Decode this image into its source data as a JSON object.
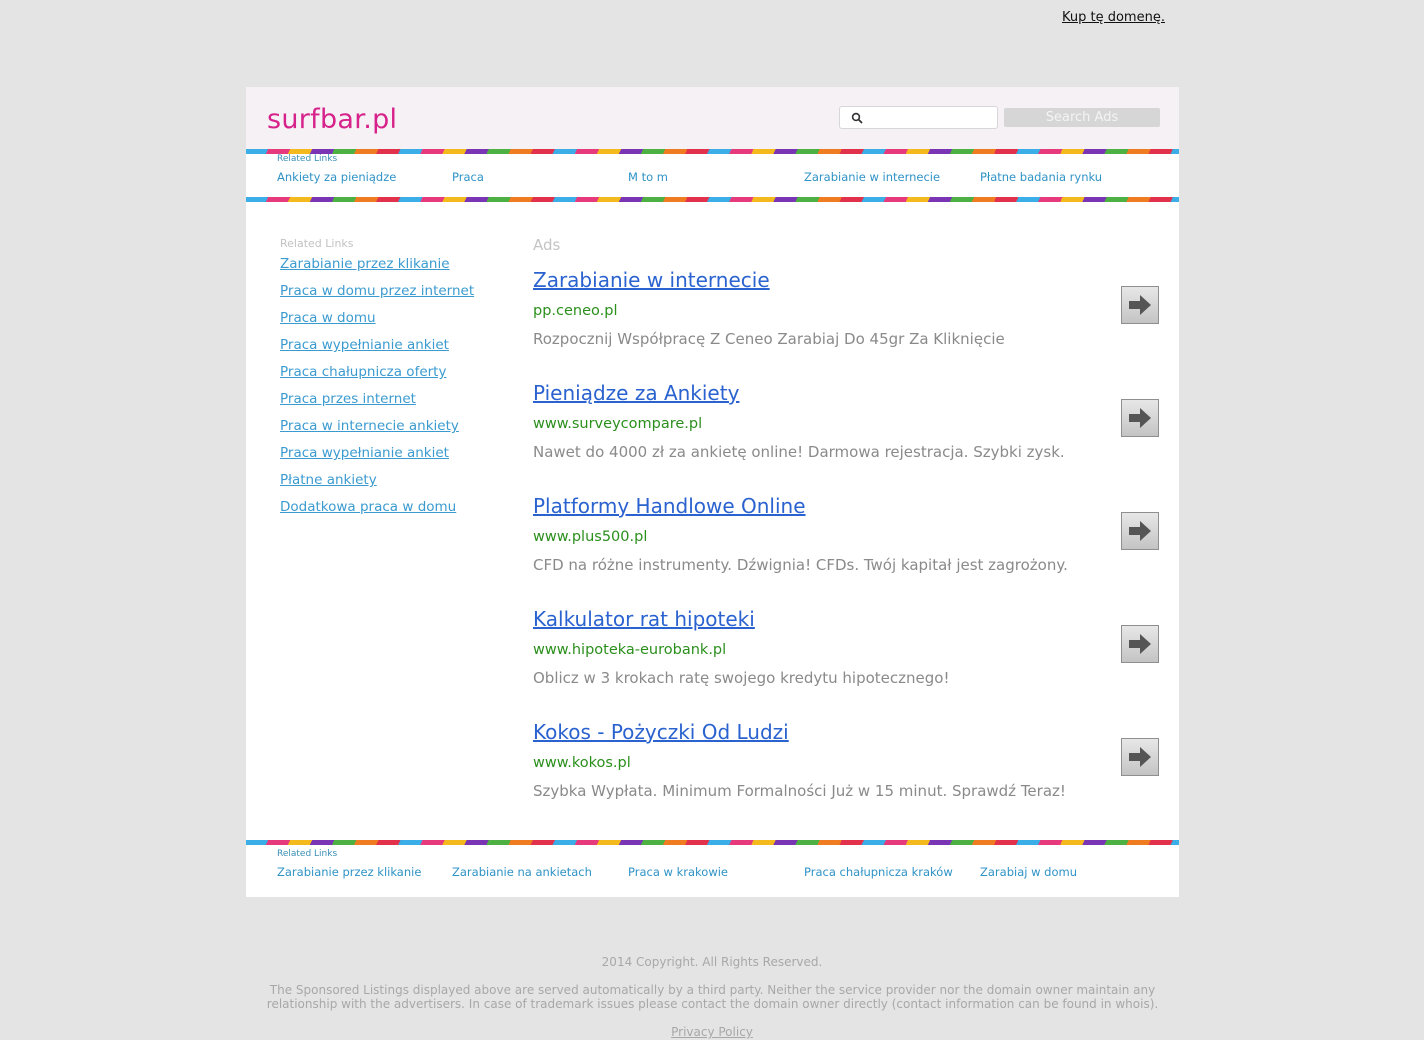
{
  "top": {
    "buy_domain": "Kup tę domenę."
  },
  "header": {
    "logo": "surfbar.pl",
    "search_placeholder": "",
    "search_button": "Search Ads"
  },
  "top_links": {
    "title": "Related Links",
    "items": [
      "Ankiety za pieniądze",
      "Praca",
      "M to m",
      "Zarabianie w internecie",
      "Płatne badania rynku"
    ]
  },
  "side_links": {
    "title": "Related Links",
    "items": [
      "Zarabianie przez klikanie",
      "Praca w domu przez internet",
      "Praca w domu",
      "Praca wypełnianie ankiet",
      "Praca chałupnicza oferty",
      "Praca przes internet",
      "Praca w internecie ankiety",
      "Praca wypełnianie ankiet",
      "Płatne ankiety",
      "Dodatkowa praca w domu"
    ]
  },
  "ads": {
    "label": "Ads",
    "items": [
      {
        "title": "Zarabianie w internecie",
        "url": "pp.ceneo.pl",
        "desc": "Rozpocznij Współpracę Z Ceneo Zarabiaj Do 45gr Za Kliknięcie"
      },
      {
        "title": "Pieniądze za Ankiety",
        "url": "www.surveycompare.pl",
        "desc": "Nawet do 4000 zł za ankietę online! Darmowa rejestracja. Szybki zysk."
      },
      {
        "title": "Platformy Handlowe Online",
        "url": "www.plus500.pl",
        "desc": "CFD na różne instrumenty. Dźwignia! CFDs. Twój kapitał jest zagrożony."
      },
      {
        "title": "Kalkulator rat hipoteki",
        "url": "www.hipoteka-eurobank.pl",
        "desc": "Oblicz w 3 krokach ratę swojego kredytu hipotecznego!"
      },
      {
        "title": "Kokos - Pożyczki Od Ludzi",
        "url": "www.kokos.pl",
        "desc": "Szybka Wypłata. Minimum Formalności Już w 15 minut. Sprawdź Teraz!"
      }
    ]
  },
  "bottom_links": {
    "title": "Related Links",
    "items": [
      "Zarabianie przez klikanie",
      "Zarabianie na ankietach",
      "Praca w krakowie",
      "Praca chałupnicza kraków",
      "Zarabiaj w domu"
    ]
  },
  "footer": {
    "copyright": "2014 Copyright. All Rights Reserved.",
    "disclaimer": "The Sponsored Listings displayed above are served automatically by a third party. Neither the service provider nor the domain owner maintain any relationship with the advertisers. In case of trademark issues please contact the domain owner directly (contact information can be found in whois).",
    "privacy": "Privacy Policy"
  }
}
